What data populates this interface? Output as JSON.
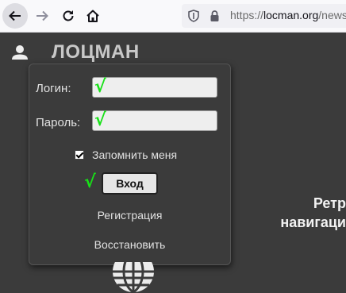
{
  "browser": {
    "url_scheme": "https://",
    "url_domain": "locman.org",
    "url_path": "/news."
  },
  "site": {
    "brand": "ЛОЦМАН"
  },
  "login_form": {
    "login_label": "Логин:",
    "password_label": "Пароль:",
    "login_check": "√",
    "password_check": "√",
    "remember_label": "Запомнить меня",
    "remember_checked": true,
    "submit_check": "√",
    "submit_label": "Вход",
    "register_link": "Регистрация",
    "restore_link": "Восстановить"
  },
  "headline": {
    "line1": "Ретр",
    "line2": "навигаци"
  },
  "colors": {
    "page_bg": "#3b3b3b",
    "check_green": "#17e217",
    "brand_text": "#c8c8c8"
  },
  "icons": [
    "back-arrow-icon",
    "forward-arrow-icon",
    "reload-icon",
    "home-icon",
    "tracking-protection-icon",
    "lock-icon",
    "user-icon",
    "globe-icon"
  ]
}
